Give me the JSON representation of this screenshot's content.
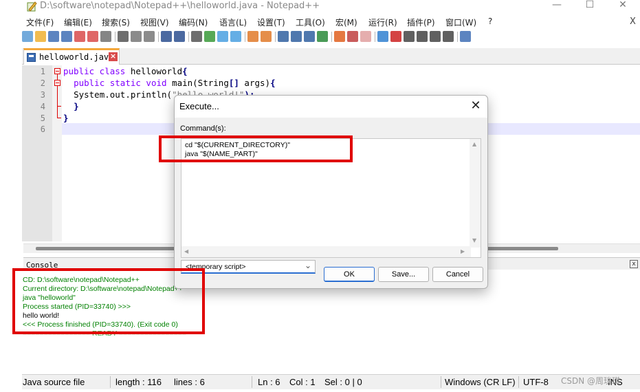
{
  "window": {
    "title": "D:\\software\\notepad\\Notepad++\\helloworld.java - Notepad++",
    "min_glyph": "—",
    "max_glyph": "☐",
    "close_glyph": "✕"
  },
  "menu": {
    "items": [
      "文件(F)",
      "编辑(E)",
      "搜索(S)",
      "视图(V)",
      "编码(N)",
      "语言(L)",
      "设置(T)",
      "工具(O)",
      "宏(M)",
      "运行(R)",
      "插件(P)",
      "窗口(W)",
      "?"
    ],
    "close_glyph": "X"
  },
  "toolbar": {
    "icons": [
      "new-file-icon",
      "open-file-icon",
      "save-icon",
      "save-all-icon",
      "close-icon",
      "close-all-icon",
      "print-icon",
      "cut-icon",
      "copy-icon",
      "paste-icon",
      "undo-icon",
      "redo-icon",
      "find-icon",
      "replace-icon",
      "zoom-in-icon",
      "zoom-out-icon",
      "sync-vertical-icon",
      "sync-horizontal-icon",
      "word-wrap-icon",
      "show-all-chars-icon",
      "indent-guide-icon",
      "language-icon",
      "doc-map-icon",
      "function-list-icon",
      "folder-workspace-icon",
      "monitoring-icon",
      "record-macro-icon",
      "stop-macro-icon",
      "play-macro-icon",
      "run-macro-multiple-icon",
      "save-macro-icon",
      "run-icon"
    ]
  },
  "tab": {
    "label": "helloworld.java",
    "close_glyph": "×"
  },
  "editor": {
    "line_numbers": [
      "1",
      "2",
      "3",
      "4",
      "5",
      "6"
    ],
    "lines": {
      "l1_kw": "public class",
      "l1_rest": " helloworld",
      "l1_brace": "{",
      "l2_indent": "  ",
      "l2_kw": "public static void",
      "l2_rest": " main(String",
      "l2_br": "[]",
      "l2_rest2": " args)",
      "l2_brace": "{",
      "l3_indent": "  ",
      "l3_rest": "System.out.println(",
      "l3_str": "\"hello world!\"",
      "l3_end": ");",
      "l4_indent": "  ",
      "l4_brace": "}",
      "l5_brace": "}"
    }
  },
  "console": {
    "title": "Console",
    "close_glyph": "x",
    "lines": [
      {
        "text": "CD: D:\\software\\notepad\\Notepad++",
        "color": "green"
      },
      {
        "text": "Current directory: D:\\software\\notepad\\Notepad++",
        "color": "green"
      },
      {
        "text": "java \"helloworld\"",
        "color": "green"
      },
      {
        "text": "Process started (PID=33740) >>>",
        "color": "green"
      },
      {
        "text": "hello world!",
        "color": "black"
      },
      {
        "text": "<<< Process finished (PID=33740). (Exit code 0)",
        "color": "green"
      },
      {
        "text": "================ READY ================",
        "color": "ready"
      }
    ]
  },
  "statusbar": {
    "file_type": "Java source file",
    "length": "length : 116",
    "lines": "lines : 6",
    "ln": "Ln : 6",
    "col": "Col : 1",
    "sel": "Sel : 0 | 0",
    "eol": "Windows (CR LF)",
    "encoding": "UTF-8",
    "mode": "INS"
  },
  "watermark": "CSDN @周琰琪",
  "dialog": {
    "title": "Execute...",
    "close_glyph": "✕",
    "commands_label": "Command(s):",
    "commands": [
      "cd \"$(CURRENT_DIRECTORY)\"",
      "java \"$(NAME_PART)\""
    ],
    "script_selected": "<temporary script>",
    "ok_label": "OK",
    "save_label": "Save...",
    "cancel_label": "Cancel"
  },
  "colors": {
    "highlight": "#e00000",
    "console_green": "#008000",
    "keyword": "#8000ff",
    "tab_accent": "#f3a63a",
    "current_line": "#e8e8ff"
  }
}
